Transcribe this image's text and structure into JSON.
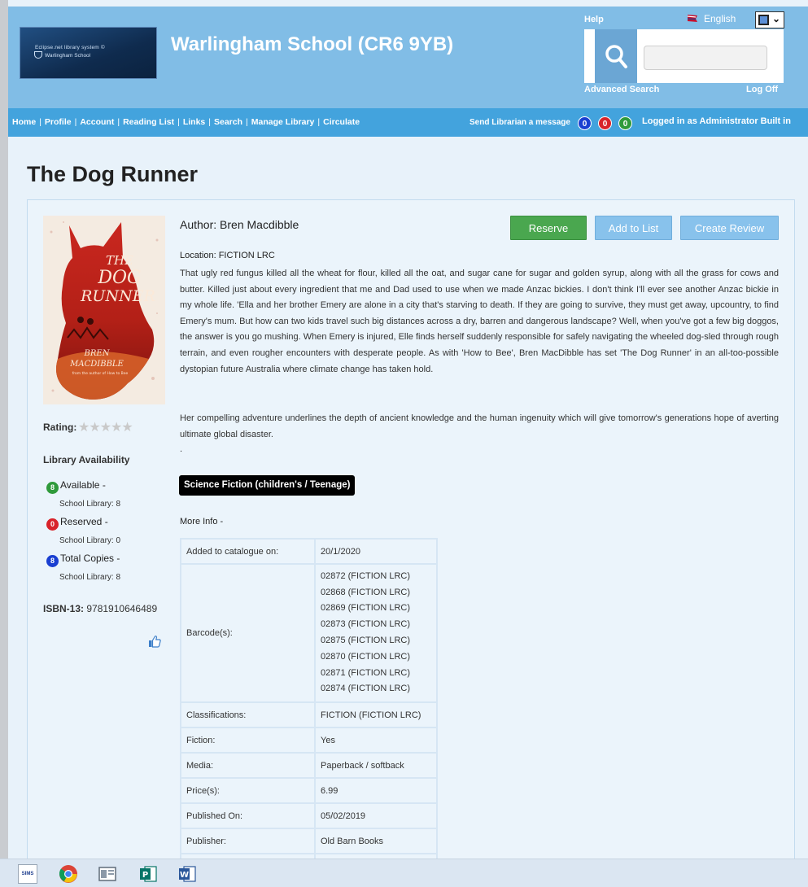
{
  "header": {
    "logo_line1": "Eclipse.net library system ©",
    "logo_line2": "Warlingham School",
    "school_title": "Warlingham School (CR6 9YB)",
    "help": "Help",
    "language": "English",
    "advanced_search": "Advanced Search",
    "log_off": "Log Off"
  },
  "nav": {
    "items": [
      "Home",
      "Profile",
      "Account",
      "Reading List",
      "Links",
      "Search",
      "Manage Library",
      "Circulate"
    ],
    "send_message": "Send Librarian a message",
    "badges": [
      {
        "count": "0",
        "color": "#1a3fd1"
      },
      {
        "count": "0",
        "color": "#d8232a"
      },
      {
        "count": "0",
        "color": "#2f9a3b"
      }
    ],
    "logged_in_prefix": "Logged in as",
    "logged_in_user": "Administrator Built in"
  },
  "book": {
    "title": "The Dog Runner",
    "author_label": "Author:",
    "author": "Bren Macdibble",
    "location": "Location: FICTION LRC",
    "description": "That ugly red fungus killed all the wheat for flour, killed all the oat, and sugar cane for sugar and golden syrup, along with all the grass for cows and butter. Killed just about every ingredient that me and Dad used to use when we made Anzac bickies. I don't think I'll ever see another Anzac bickie in my whole life. 'Ella and her brother Emery are alone in a city that's starving to death. If they are going to survive, they must get away, upcountry, to find Emery's mum. But how can two kids travel such big distances across a dry, barren and dangerous landscape? Well, when you've got a few big doggos, the answer is you go mushing. When Emery is injured, Elle finds herself suddenly responsible for safely navigating the wheeled dog-sled through rough terrain, and even rougher encounters with desperate people. As with 'How to Bee', Bren MacDibble has set 'The Dog Runner' in an all-too-possible dystopian future Australia where climate change has taken hold.",
    "description2": "Her compelling adventure underlines the depth of ancient knowledge and the human ingenuity which will give tomorrow's generations hope of averting ultimate global disaster.",
    "dot": ".",
    "genre": "Science Fiction (children's / Teenage)",
    "more_info": "More Info -",
    "cover": {
      "title_line1": "THE",
      "title_line2": "DOG",
      "title_line3": "RUNNER",
      "author_line1": "BREN",
      "author_line2": "MACDIBBLE",
      "tagline": "from the author of How to Bee"
    }
  },
  "actions": {
    "reserve": "Reserve",
    "add_to_list": "Add to List",
    "create_review": "Create Review"
  },
  "sidebar": {
    "rating_label": "Rating:",
    "stars": "★★★★★",
    "availability_title": "Library Availability",
    "available": {
      "count": "8",
      "label": "Available -",
      "sub": "School Library: 8",
      "color": "#2f9a3b"
    },
    "reserved": {
      "count": "0",
      "label": "Reserved -",
      "sub": "School Library: 0",
      "color": "#d8232a"
    },
    "total": {
      "count": "8",
      "label": "Total Copies -",
      "sub": "School Library: 8",
      "color": "#1a3fd1"
    },
    "isbn_label": "ISBN-13:",
    "isbn": "9781910646489"
  },
  "info_table": {
    "added_label": "Added to catalogue on:",
    "added": "20/1/2020",
    "barcodes_label": "Barcode(s):",
    "barcodes": [
      "02872 (FICTION LRC)",
      "02868 (FICTION LRC)",
      "02869 (FICTION LRC)",
      "02873 (FICTION LRC)",
      "02875 (FICTION LRC)",
      "02870 (FICTION LRC)",
      "02871 (FICTION LRC)",
      "02874 (FICTION LRC)"
    ],
    "classifications_label": "Classifications:",
    "classifications": "FICTION (FICTION LRC)",
    "fiction_label": "Fiction:",
    "fiction": "Yes",
    "media_label": "Media:",
    "media": "Paperback / softback",
    "price_label": "Price(s):",
    "price": "6.99",
    "published_label": "Published On:",
    "published": "05/02/2019",
    "publisher_label": "Publisher:",
    "publisher": "Old Barn Books"
  },
  "taskbar": {
    "sims_label": "SIMS",
    "icons": [
      "sims-icon",
      "chrome-icon",
      "app-window-icon",
      "publisher-icon",
      "word-icon"
    ]
  }
}
